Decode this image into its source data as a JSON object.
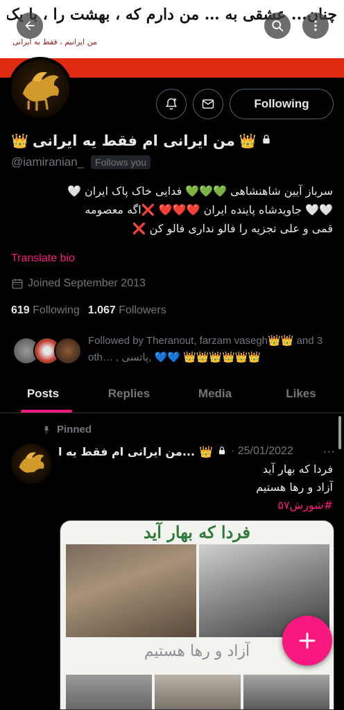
{
  "banner": {
    "text": "چنان... عشقی به … من دارم که ، بهشت را ، با یک وجب از خاک ایران عوض نمیکنم",
    "subtext": "من ایرانیم ، فقط یه ایرانی",
    "colors": {
      "background": "#ffffff",
      "band": "#e02a12"
    }
  },
  "header": {
    "back_icon": "arrow-left-icon",
    "search_icon": "search-icon",
    "more_icon": "more-icon"
  },
  "profile": {
    "display_name": "من ایرانی ام فقط یه ایرانی",
    "crown_left": "👑",
    "crown_right": "👑",
    "handle": "@iamiranian_",
    "follows_you": "Follows you",
    "bio_line1": "سرباز آیین شاهنشاهی 💚💚💚 فدایی خاک پاک ایران 🤍",
    "bio_line2": "🤍🤍 جاویدشاه پاینده ایران ❤️❤️❤️ ❌اگه معصومه",
    "bio_line3": "قمی و علی تجزیه را فالو نداری فالو کن ❌",
    "translate": "Translate bio",
    "joined": "Joined September 2013",
    "following_count": "619",
    "following_label": "Following",
    "followers_count": "1.067",
    "followers_label": "Followers",
    "followed_by": "Followed by Theranout, farzam vasegh👑👑 and 3 oth… , پاتسی, 💙💙 👑👑👑👑👑👑"
  },
  "actions": {
    "notify_icon": "bell-plus-icon",
    "message_icon": "envelope-icon",
    "following_button": "Following"
  },
  "tabs": [
    {
      "label": "Posts",
      "active": true
    },
    {
      "label": "Replies",
      "active": false
    },
    {
      "label": "Media",
      "active": false
    },
    {
      "label": "Likes",
      "active": false
    }
  ],
  "tweet": {
    "pinned": "Pinned",
    "name": "من ایرانی ام فقط یه ا...",
    "crown": "👑",
    "date": "· 25/01/2022",
    "more": "···",
    "line1": "فردا که بهار آید",
    "line2": "آزاد و رها هستیم",
    "hashtag": "#شورش۵۷"
  },
  "media": {
    "title1": "فردا که بهار آید",
    "title2": "آزاد و رها هستیم"
  },
  "fab": {
    "icon": "plus-icon",
    "color": "#f91880"
  },
  "colors": {
    "accent": "#f91880",
    "muted": "#71767b",
    "text": "#e7e9ea"
  }
}
